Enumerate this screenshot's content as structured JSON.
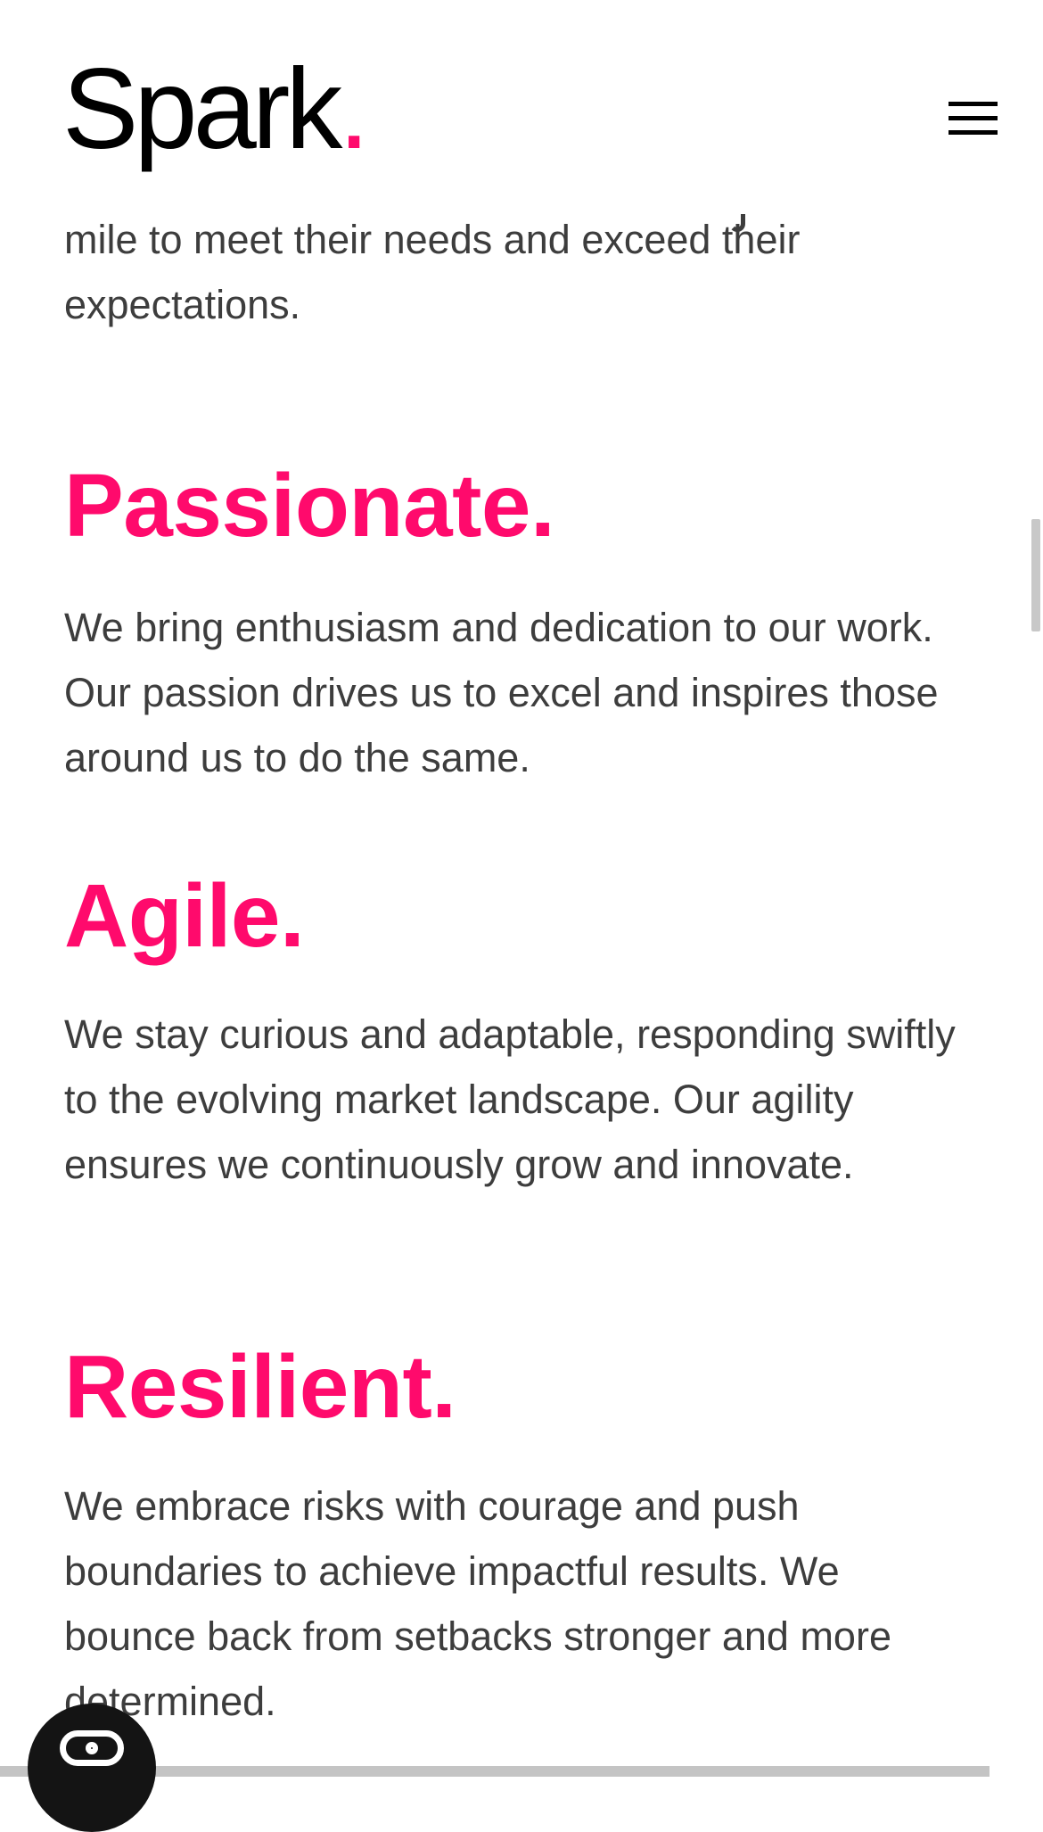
{
  "header": {
    "logo_text": "Spark",
    "logo_dot": ".",
    "menu_icon": "hamburger-menu-icon"
  },
  "intro": {
    "line_1": "mile to meet their needs and exceed their",
    "line_2": "expectations."
  },
  "values": [
    {
      "heading": "Passionate.",
      "text": "We bring enthusiasm and dedication to our work. Our passion drives us to excel and inspires those around us to do the same."
    },
    {
      "heading": "Agile.",
      "text": "We stay curious and adaptable, responding swiftly to the evolving market landscape. Our agility ensures we continuously grow and innovate."
    },
    {
      "heading": "Resilient.",
      "text": "We embrace risks with courage and push boundaries to achieve impactful results. We bounce back from setbacks stronger and more determined."
    }
  ],
  "chat": {
    "icon": "chat-bubble-icon"
  },
  "colors": {
    "accent": "#ff0a6c",
    "body_text": "#3d3d3d",
    "logo": "#000000"
  }
}
